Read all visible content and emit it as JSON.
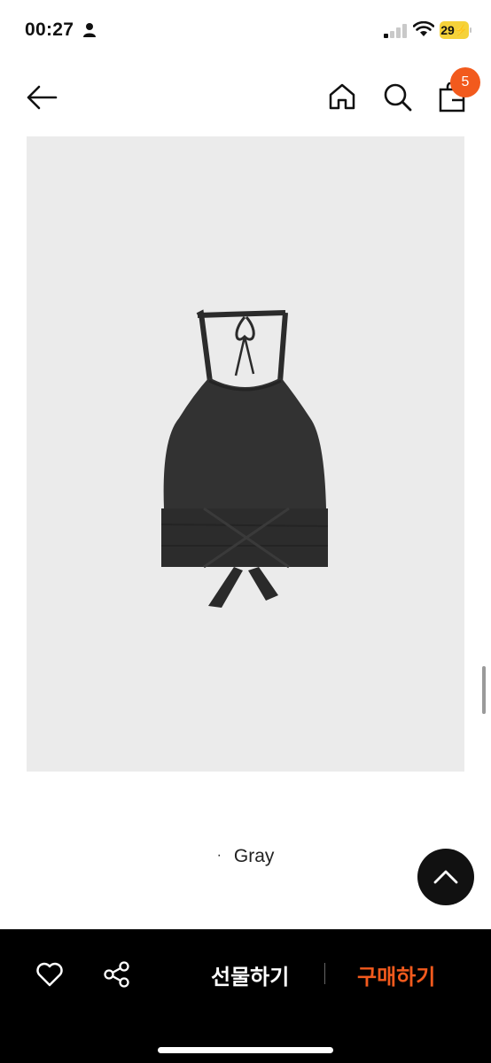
{
  "status_bar": {
    "time": "00:27",
    "battery": "29",
    "icons": [
      "person-icon",
      "signal-icon",
      "wifi-icon",
      "battery-icon"
    ]
  },
  "nav": {
    "icons": [
      "back-arrow-icon",
      "home-icon",
      "search-icon",
      "shopping-bag-icon"
    ],
    "cart_count": "5"
  },
  "product": {
    "image": "halter-top-product-image",
    "option_bullet": "·",
    "option_label": "Gray"
  },
  "bottom_bar": {
    "icons": [
      "heart-icon",
      "share-icon",
      "chevron-up-icon"
    ],
    "gift_label": "선물하기",
    "buy_label": "구매하기"
  },
  "colors": {
    "accent": "#f25a1d",
    "image_background": "#ebebeb",
    "bottom_bar": "#000000",
    "battery": "#f5d23a"
  }
}
